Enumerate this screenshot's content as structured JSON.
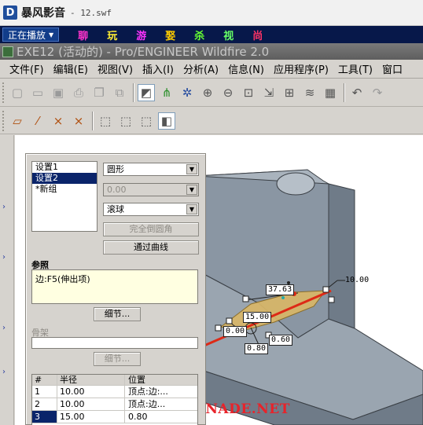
{
  "player": {
    "logo": "D",
    "name": "暴风影音",
    "file": "- 12.swf",
    "now_playing": "正在播放",
    "links": [
      {
        "label": "聊",
        "color": "#ff33cc"
      },
      {
        "label": "玩",
        "color": "#ffee33"
      },
      {
        "label": "游",
        "color": "#ff33ff"
      },
      {
        "label": "娶",
        "color": "#ffcc00"
      },
      {
        "label": "杀",
        "color": "#66ff33"
      },
      {
        "label": "视",
        "color": "#66ff66"
      },
      {
        "label": "尚",
        "color": "#ff3366"
      }
    ]
  },
  "app": {
    "title": "EXE12 (活动的) - Pro/ENGINEER Wildfire 2.0"
  },
  "menu": {
    "items": [
      "文件(F)",
      "编辑(E)",
      "视图(V)",
      "插入(I)",
      "分析(A)",
      "信息(N)",
      "应用程序(P)",
      "工具(T)",
      "窗口"
    ]
  },
  "panel": {
    "sets": [
      "设置1",
      "设置2",
      "*新组"
    ],
    "selected_set_index": 1,
    "shape_value": "圆形",
    "radius_value": "0.00",
    "method_value": "滚球",
    "full_round_label": "完全倒圆角",
    "through_curve_label": "通过曲线",
    "reference_label": "参照",
    "reference_value": "边:F5(伸出项)",
    "details_label": "细节...",
    "frame_label": "骨架",
    "frame_details_label": "细节...",
    "table": {
      "headers": [
        "#",
        "半径",
        "位置"
      ],
      "rows": [
        {
          "index": "1",
          "radius": "10.00",
          "position": "顶点:边:..."
        },
        {
          "index": "2",
          "radius": "10.00",
          "position": "顶点:边..."
        },
        {
          "index": "3",
          "radius": "15.00",
          "position": "0.80"
        }
      ],
      "selected_row_index": 2
    }
  },
  "graphics": {
    "dimensions": {
      "d1": "10.00",
      "d2": "37.63",
      "d3": "15.00",
      "d4": "0.00",
      "d5": "0.60",
      "d6": "0.80"
    },
    "watermark": "BBS.CHINADE.NET",
    "colors": {
      "model_face": "#8a96a3",
      "model_side": "#6f7b88",
      "model_top": "#a9b3bd",
      "fillet_surface": "#d9b768",
      "edge_highlight": "#dd2a16"
    }
  },
  "toolbar": {
    "icons": [
      "new-icon",
      "open-icon",
      "save-icon",
      "print-icon",
      "copy-icon",
      "paste-icon",
      "repaint-icon",
      "datum-icon",
      "orient-icon",
      "zoom-in-icon",
      "zoom-out-icon",
      "refit-icon",
      "spin-icon",
      "saved-views-icon",
      "layers-icon",
      "model-tree-icon",
      "undo-icon",
      "redo-icon"
    ],
    "display_icons": [
      "datum-plane-icon",
      "datum-axis-icon",
      "datum-point-icon",
      "coord-sys-icon",
      "wireframe-icon",
      "hidden-line-icon",
      "no-hidden-icon",
      "shading-icon"
    ]
  }
}
